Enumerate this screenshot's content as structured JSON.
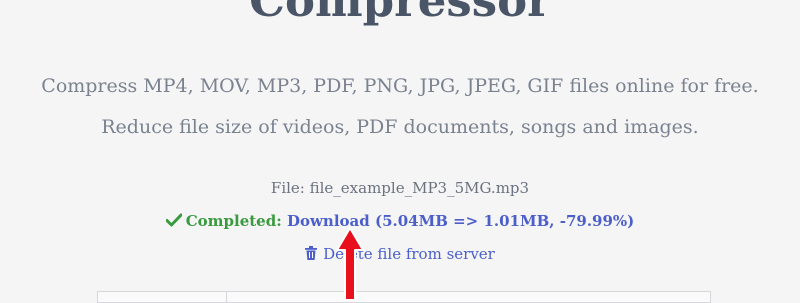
{
  "header": {
    "title": "Compressor",
    "subtitle_line1": "Compress MP4, MOV, MP3, PDF, PNG, JPG, JPEG, GIF files online for free.",
    "subtitle_line2": "Reduce file size of videos, PDF documents, songs and images."
  },
  "result": {
    "file_label": "File: file_example_MP3_5MG.mp3",
    "status_label": "Completed:",
    "download_label": "Download",
    "size_info": "(5.04MB => 1.01MB, -79.99%)",
    "delete_label": "Delete file from server"
  },
  "icons": {
    "status": "check-icon",
    "delete": "trash-icon",
    "pointer": "red-arrow-icon"
  },
  "colors": {
    "completed": "#3a9a3f",
    "link": "#4b5ec9",
    "arrow": "#e8101c"
  }
}
